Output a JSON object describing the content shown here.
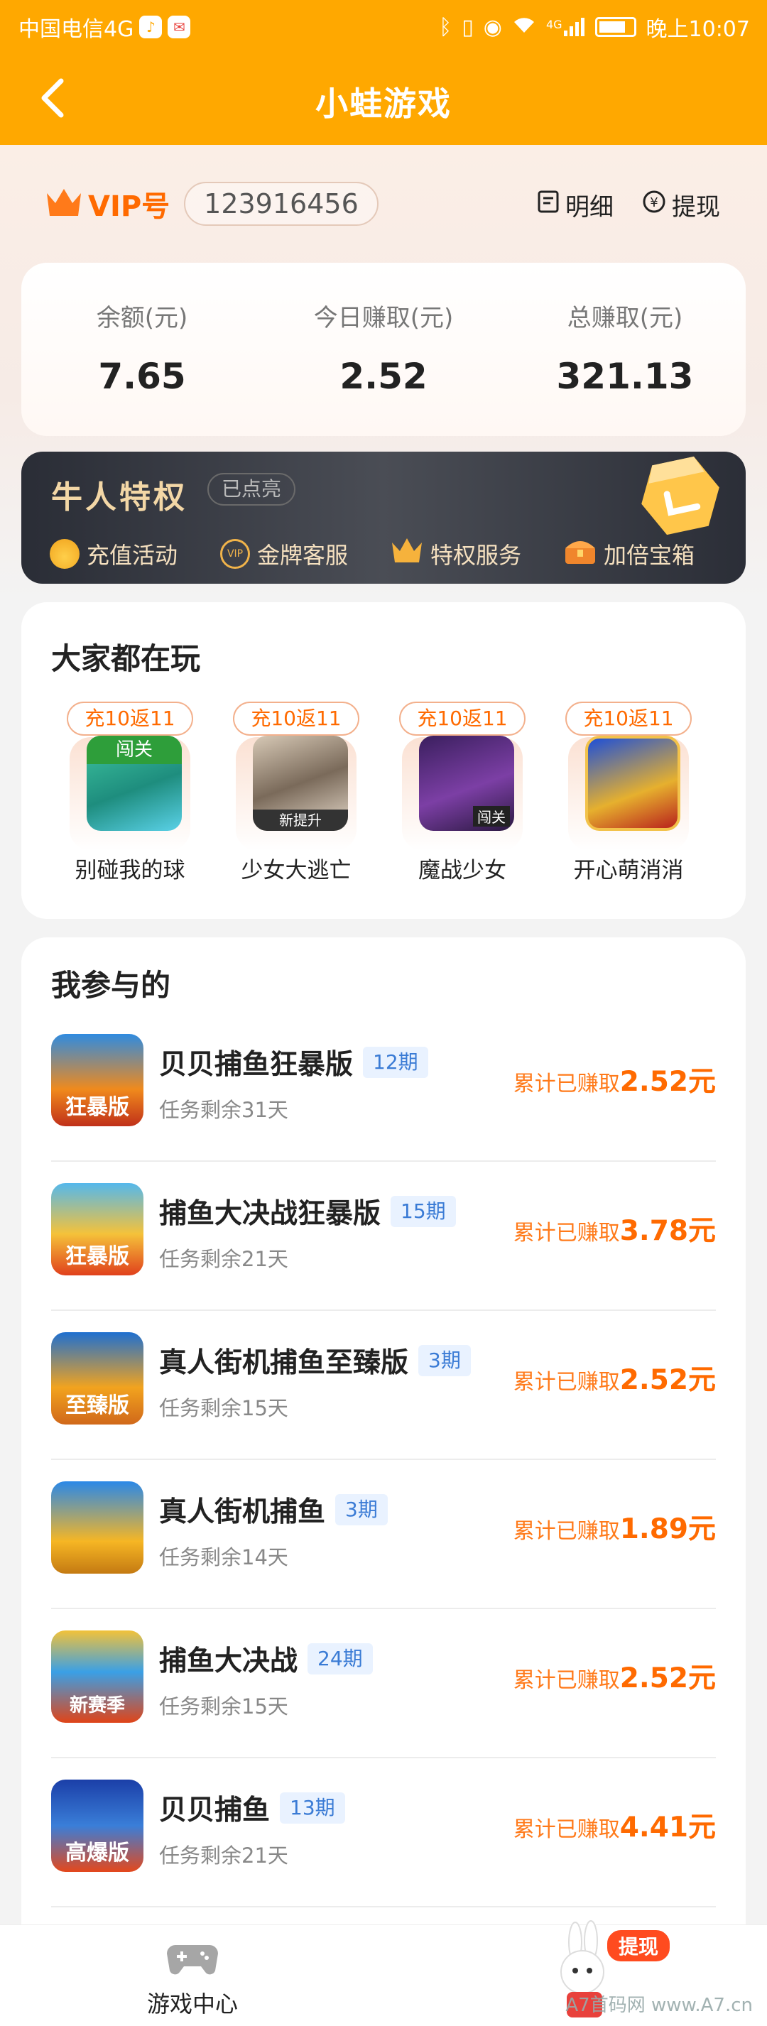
{
  "status_bar": {
    "carrier": "中国电信4G",
    "network": "4G",
    "time": "晚上10:07"
  },
  "header": {
    "title": "小蛙游戏",
    "back_icon": "back-arrow-icon"
  },
  "account": {
    "vip_label": "VIP号",
    "vip_number": "123916456",
    "detail_label": "明细",
    "withdraw_label": "提现"
  },
  "stats": [
    {
      "label": "余额(元)",
      "value": "7.65"
    },
    {
      "label": "今日赚取(元)",
      "value": "2.52"
    },
    {
      "label": "总赚取(元)",
      "value": "321.13"
    }
  ],
  "privilege": {
    "title": "牛人特权",
    "status": "已点亮",
    "features": [
      {
        "label": "充值活动",
        "icon": "money-bag-icon"
      },
      {
        "label": "金牌客服",
        "icon": "vip-badge-icon"
      },
      {
        "label": "特权服务",
        "icon": "crown-icon"
      },
      {
        "label": "加倍宝箱",
        "icon": "treasure-chest-icon"
      }
    ]
  },
  "popular": {
    "heading": "大家都在玩",
    "games": [
      {
        "tag": "充10返11",
        "name": "别碰我的球",
        "icon_text": "闯关"
      },
      {
        "tag": "充10返11",
        "name": "少女大逃亡",
        "icon_text": "新提升"
      },
      {
        "tag": "充10返11",
        "name": "魔战少女",
        "icon_text": "闯关"
      },
      {
        "tag": "充10返11",
        "name": "开心萌消消",
        "icon_text": ""
      }
    ]
  },
  "participated": {
    "heading": "我参与的",
    "earn_prefix": "累计已赚取",
    "items": [
      {
        "name": "贝贝捕鱼狂暴版",
        "period": "12期",
        "remaining": "任务剩余31天",
        "earned": "2.52元",
        "icon_text": "狂暴版"
      },
      {
        "name": "捕鱼大决战狂暴版",
        "period": "15期",
        "remaining": "任务剩余21天",
        "earned": "3.78元",
        "icon_text": "狂暴版"
      },
      {
        "name": "真人街机捕鱼至臻版",
        "period": "3期",
        "remaining": "任务剩余15天",
        "earned": "2.52元",
        "icon_text": "至臻版"
      },
      {
        "name": "真人街机捕鱼",
        "period": "3期",
        "remaining": "任务剩余14天",
        "earned": "1.89元",
        "icon_text": ""
      },
      {
        "name": "捕鱼大决战",
        "period": "24期",
        "remaining": "任务剩余15天",
        "earned": "2.52元",
        "icon_text": "新赛季"
      },
      {
        "name": "贝贝捕鱼",
        "period": "13期",
        "remaining": "任务剩余21天",
        "earned": "4.41元",
        "icon_text": "高爆版"
      }
    ]
  },
  "tabbar": {
    "home_label": "游戏中心",
    "withdraw_badge": "提现"
  },
  "watermark": "A7首码网 www.A7.cn"
}
